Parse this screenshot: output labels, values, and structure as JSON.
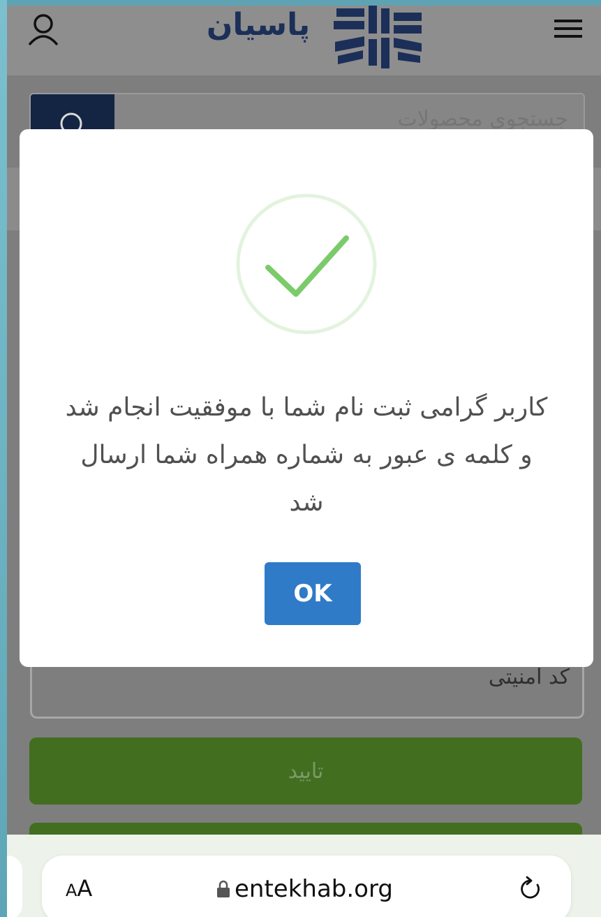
{
  "header": {
    "logo_text": "پاسیان",
    "icons": {
      "user": "user-icon",
      "menu": "hamburger-menu-icon",
      "logo": "logo-emblem-icon"
    }
  },
  "search": {
    "placeholder": "جستجوی محصولات",
    "icon": "search-icon"
  },
  "form": {
    "captcha_label": "کد امنیتی",
    "submit_label": "تایید"
  },
  "modal": {
    "icon": "checkmark-icon",
    "message": "کاربر گرامی ثبت نام شما با موفقیت انجام شد و کلمه ی عبور به شماره همراه شما ارسال شد",
    "ok_label": "OK"
  },
  "browser": {
    "aa_label_small": "A",
    "aa_label_large": "A",
    "url": "entekhab.org",
    "icons": {
      "lock": "lock-icon",
      "reload": "reload-icon"
    }
  },
  "colors": {
    "brand_navy": "#1b2f58",
    "success_green": "#7ccb6b",
    "ok_blue": "#2f7bc7",
    "submit_green": "#426e20"
  }
}
